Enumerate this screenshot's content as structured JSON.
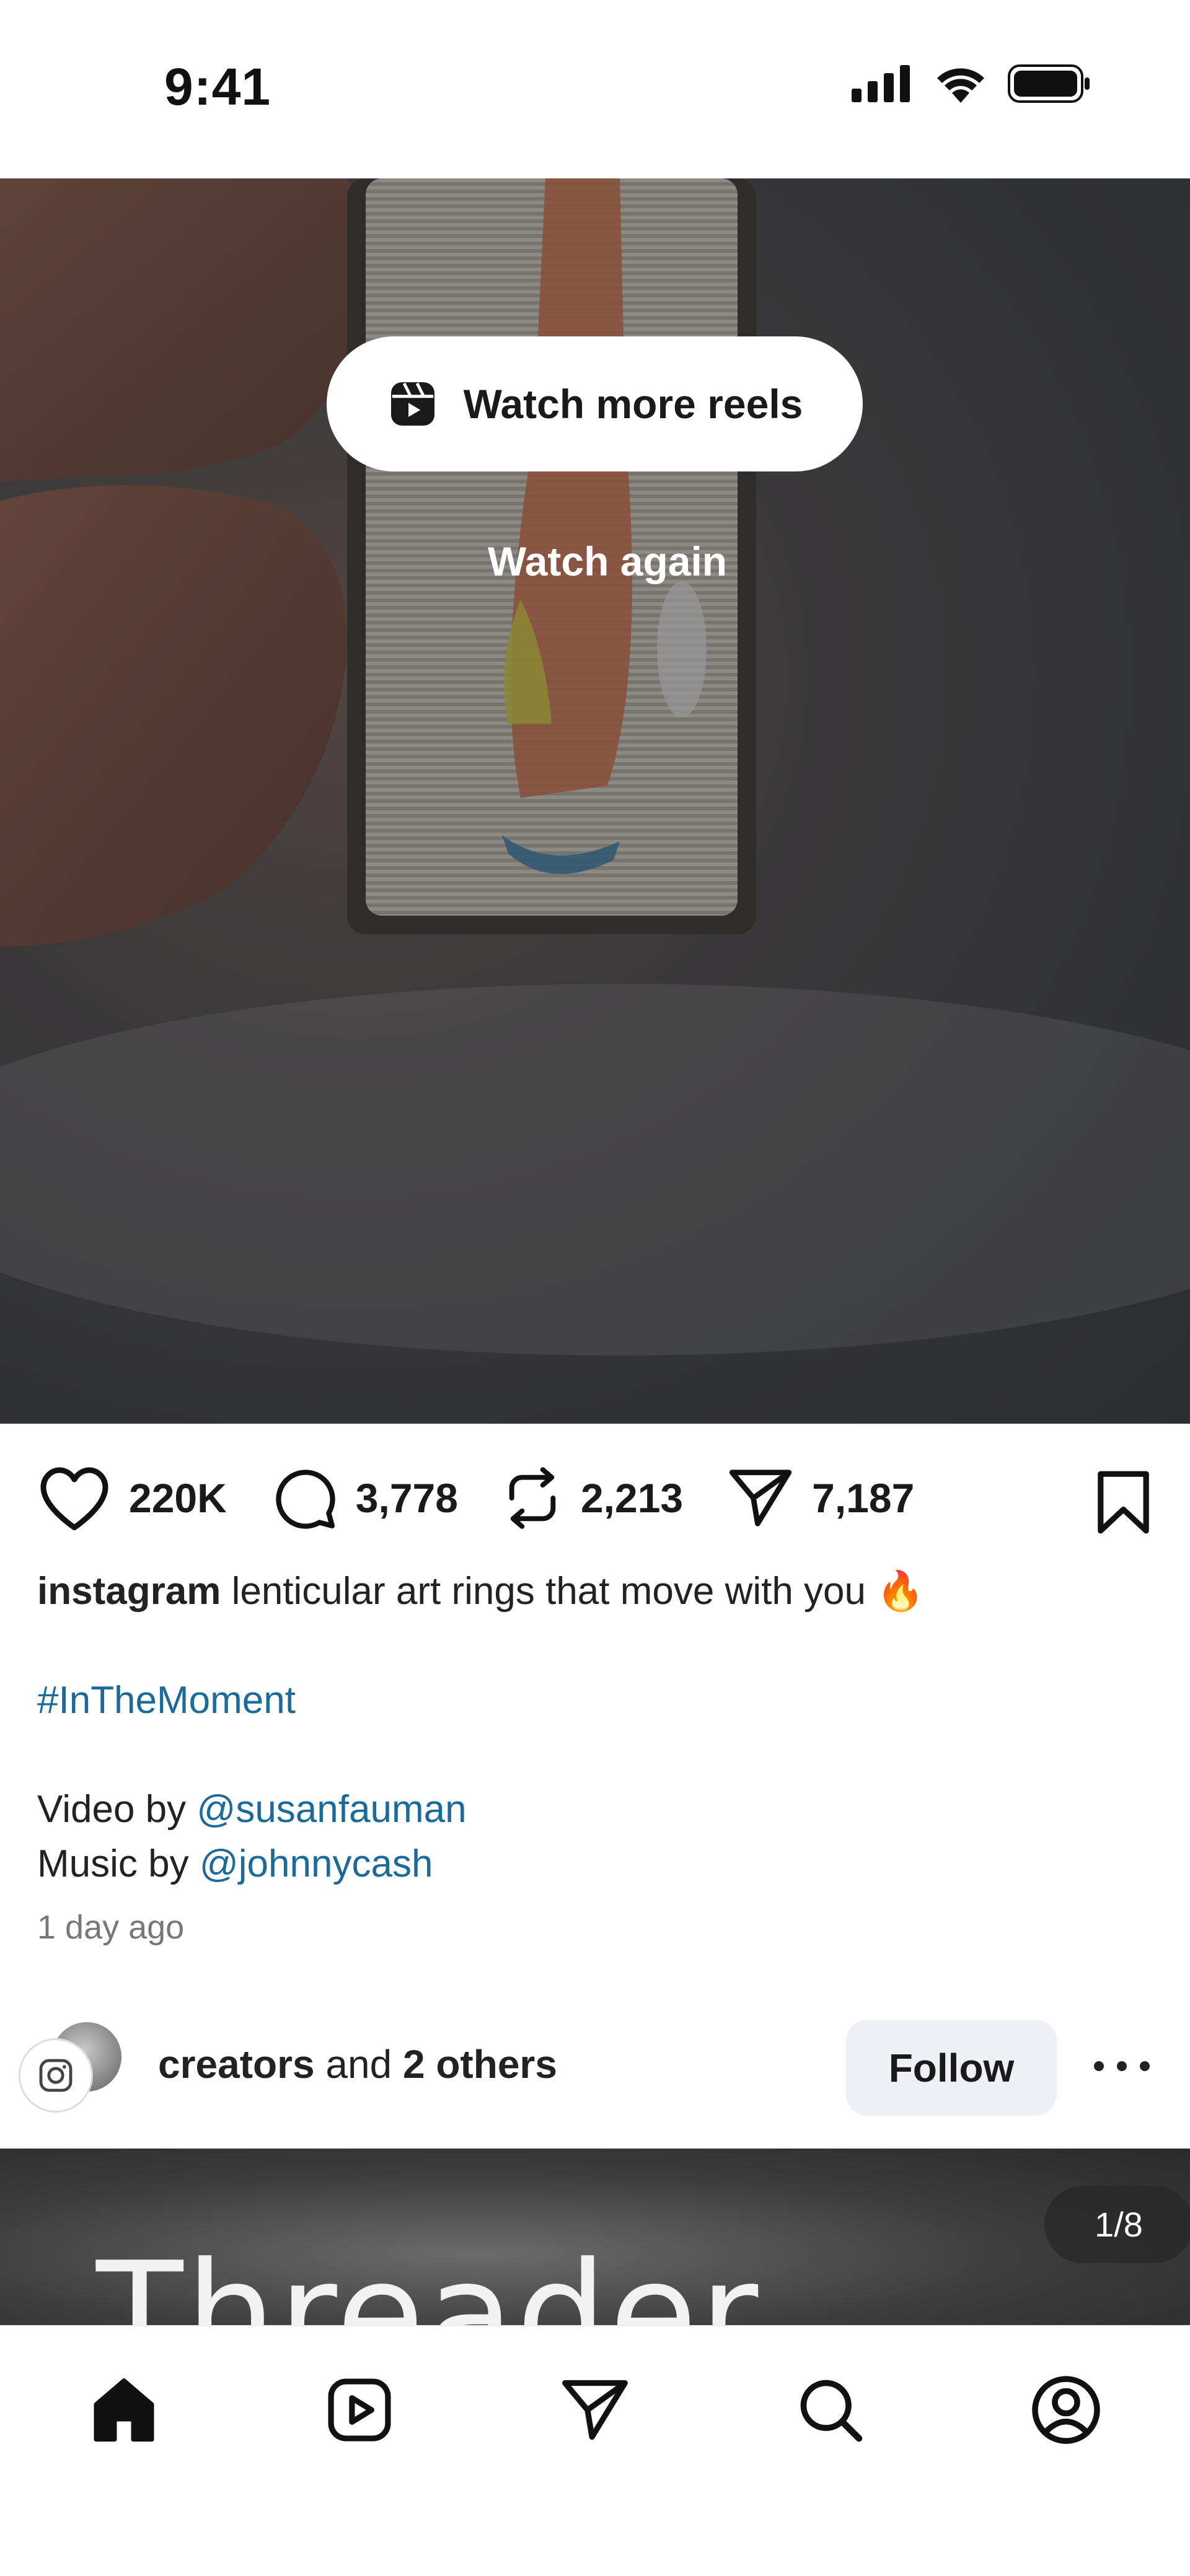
{
  "status_bar": {
    "time": "9:41"
  },
  "reel": {
    "watch_more_label": "Watch more reels",
    "watch_again_label": "Watch again"
  },
  "actions": {
    "likes": "220K",
    "comments": "3,778",
    "reposts": "2,213",
    "shares": "7,187"
  },
  "caption": {
    "username": "instagram",
    "text": "lenticular art rings that move with you 🔥",
    "hashtag": "#InTheMoment",
    "video_by_prefix": "Video by ",
    "video_by_handle": "@susanfauman",
    "music_by_prefix": "Music by ",
    "music_by_handle": "@johnnycash",
    "timestamp": "1 day ago"
  },
  "creators": {
    "lead": "creators",
    "middle": " and ",
    "others": "2 others",
    "follow_label": "Follow"
  },
  "next_post": {
    "title": "Threader",
    "page_indicator": "1/8"
  },
  "tab_bar": {
    "items": [
      "home-icon",
      "reels-icon",
      "direct-icon",
      "search-icon",
      "profile-icon"
    ]
  }
}
